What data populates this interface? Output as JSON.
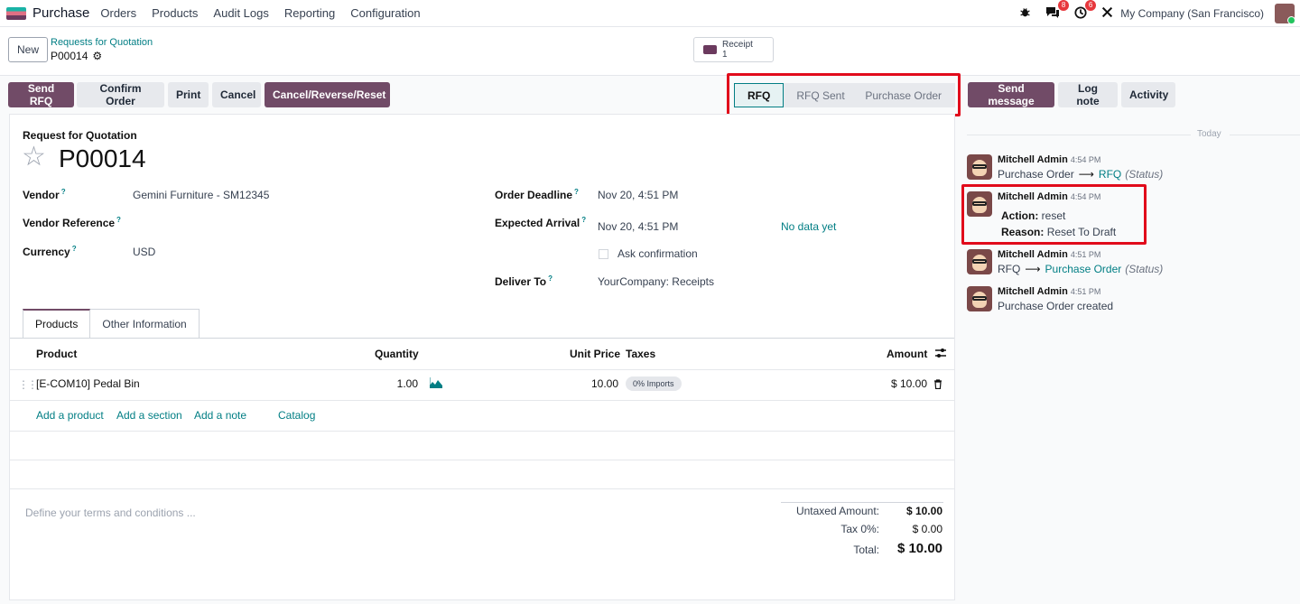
{
  "nav": {
    "app_name": "Purchase",
    "menu": [
      "Orders",
      "Products",
      "Audit Logs",
      "Reporting",
      "Configuration"
    ],
    "messages_badge": "8",
    "activities_badge": "6",
    "company": "My Company (San Francisco)"
  },
  "control": {
    "new_label": "New",
    "breadcrumb": "Requests for Quotation",
    "record": "P00014",
    "receipt_label": "Receipt",
    "receipt_count": "1"
  },
  "actions": {
    "send_rfq": "Send RFQ",
    "confirm_order": "Confirm Order",
    "print": "Print",
    "cancel": "Cancel",
    "cancel_reverse_reset": "Cancel/Reverse/Reset"
  },
  "status": {
    "stages": [
      "RFQ",
      "RFQ Sent",
      "Purchase Order"
    ],
    "active": "RFQ"
  },
  "form": {
    "doc_type": "Request for Quotation",
    "name": "P00014",
    "vendor_label": "Vendor",
    "vendor": "Gemini Furniture - SM12345",
    "vendor_ref_label": "Vendor Reference",
    "currency_label": "Currency",
    "currency": "USD",
    "deadline_label": "Order Deadline",
    "deadline": "Nov 20, 4:51 PM",
    "arrival_label": "Expected Arrival",
    "arrival": "Nov 20, 4:51 PM",
    "no_data": "No data yet",
    "ask_confirmation": "Ask confirmation",
    "deliver_to_label": "Deliver To",
    "deliver_to": "YourCompany: Receipts",
    "help_mark": "?"
  },
  "tabs": [
    "Products",
    "Other Information"
  ],
  "lines": {
    "columns": {
      "product": "Product",
      "quantity": "Quantity",
      "unit_price": "Unit Price",
      "taxes": "Taxes",
      "amount": "Amount"
    },
    "rows": [
      {
        "product": "[E-COM10] Pedal Bin",
        "quantity": "1.00",
        "unit_price": "10.00",
        "tax": "0% Imports",
        "amount": "$ 10.00"
      }
    ],
    "add_product": "Add a product",
    "add_section": "Add a section",
    "add_note": "Add a note",
    "catalog": "Catalog"
  },
  "terms_placeholder": "Define your terms and conditions ...",
  "totals": {
    "untaxed_label": "Untaxed Amount:",
    "untaxed": "$ 10.00",
    "tax_label": "Tax 0%:",
    "tax": "$ 0.00",
    "total_label": "Total:",
    "total": "$ 10.00"
  },
  "chatter": {
    "send_message": "Send message",
    "log_note": "Log note",
    "activity": "Activity",
    "today": "Today",
    "messages": [
      {
        "author": "Mitchell Admin",
        "time": "4:54 PM",
        "from": "Purchase Order",
        "to": "RFQ",
        "field": "(Status)"
      },
      {
        "author": "Mitchell Admin",
        "time": "4:54 PM",
        "action_label": "Action:",
        "action": "reset",
        "reason_label": "Reason:",
        "reason": "Reset To Draft"
      },
      {
        "author": "Mitchell Admin",
        "time": "4:51 PM",
        "from": "RFQ",
        "to": "Purchase Order",
        "field": "(Status)"
      },
      {
        "author": "Mitchell Admin",
        "time": "4:51 PM",
        "text": "Purchase Order created"
      }
    ]
  },
  "colors": {
    "brand": "#714b67",
    "link": "#017e84",
    "highlight": "#e10b1b"
  }
}
